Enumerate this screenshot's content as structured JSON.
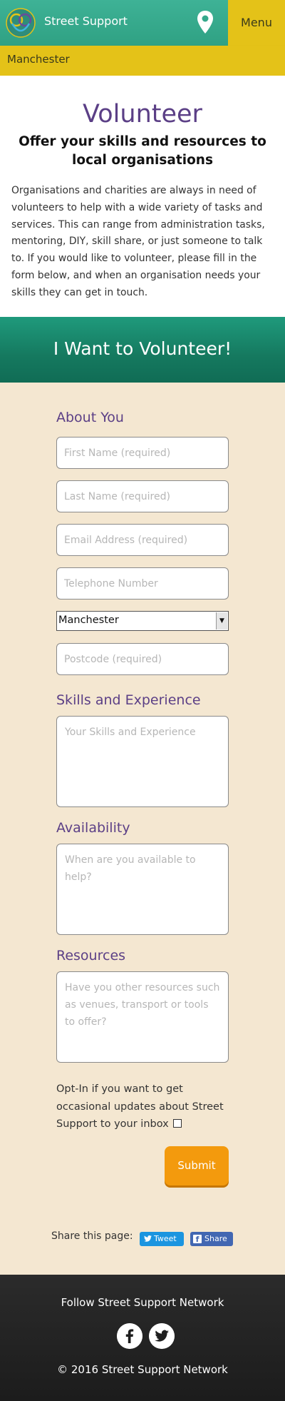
{
  "header": {
    "brand": "Street Support",
    "menu_label": "Menu",
    "logo_icon": "street-support-logo",
    "location_icon": "map-pin-icon",
    "city": "Manchester"
  },
  "intro": {
    "title": "Volunteer",
    "subtitle": "Offer your skills and resources to local organisations",
    "body": "Organisations and charities are always in need of volunteers to help with a wide variety of tasks and services. This can range from administration tasks, mentoring, DIY, skill share, or just someone to talk to. If you would like to volunteer, please fill in the form below, and when an organisation needs your skills they can get in touch."
  },
  "banner": {
    "title": "I Want to Volunteer!"
  },
  "form": {
    "about_heading": "About You",
    "first_name_placeholder": "First Name (required)",
    "last_name_placeholder": "Last Name (required)",
    "email_placeholder": "Email Address (required)",
    "telephone_placeholder": "Telephone Number",
    "city_selected": "Manchester",
    "postcode_placeholder": "Postcode (required)",
    "skills_heading": "Skills and Experience",
    "skills_placeholder": "Your Skills and Experience",
    "availability_heading": "Availability",
    "availability_placeholder": "When are you available to help?",
    "resources_heading": "Resources",
    "resources_placeholder": "Have you other resources such as venues, transport or tools to offer?",
    "optin_text": "Opt-In if you want to get occasional updates about Street Support to your inbox",
    "optin_checked": false,
    "submit_label": "Submit"
  },
  "share": {
    "label": "Share this page:",
    "tweet_label": "Tweet",
    "facebook_label": "Share"
  },
  "footer": {
    "follow": "Follow Street Support Network",
    "copyright": "© 2016 Street Support Network",
    "icons": [
      "facebook-icon",
      "twitter-icon"
    ]
  },
  "colors": {
    "header_green": "#3eb296",
    "accent_yellow": "#e4c218",
    "heading_purple": "#5b3f86",
    "form_background": "#f4e7d1",
    "submit_orange": "#f39a0d",
    "footer_dark": "#222222"
  }
}
